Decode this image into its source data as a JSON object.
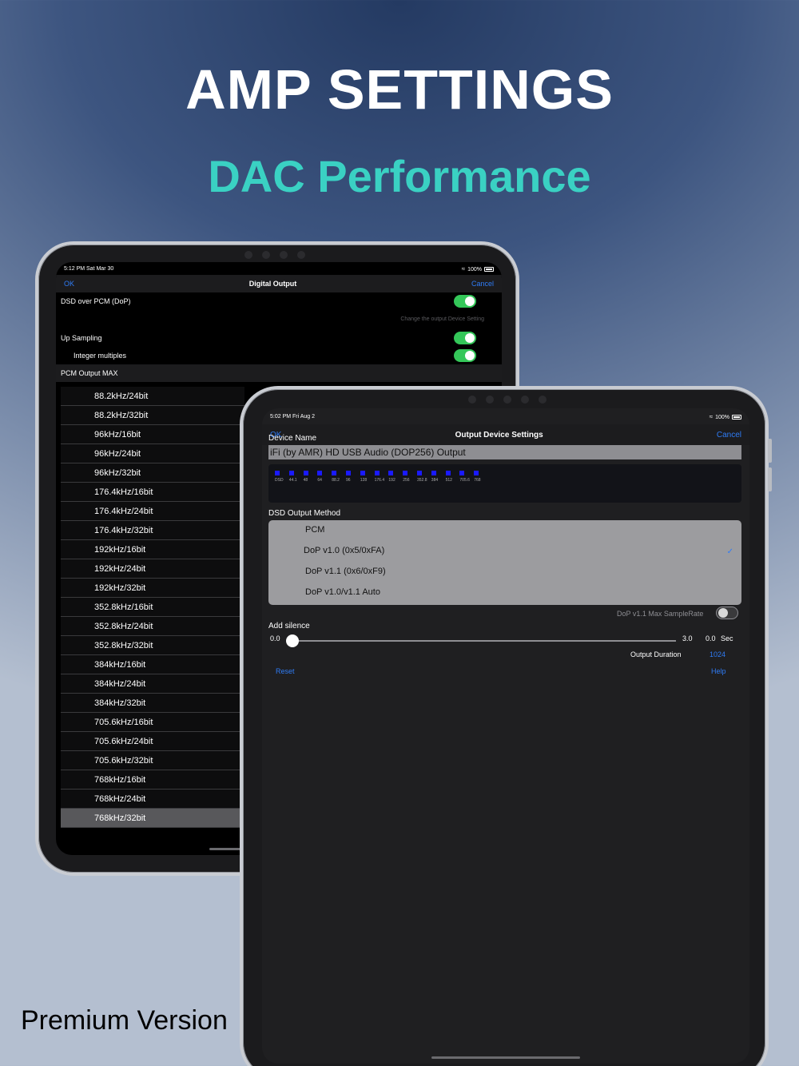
{
  "headline": "AMP SETTINGS",
  "subheadline": "DAC Performance",
  "footer_label": "Premium Version",
  "colors": {
    "accent_teal": "#3ad1c3",
    "ios_blue": "#2f7cf6",
    "toggle_green": "#34c759"
  },
  "back_device": {
    "status": {
      "time": "5:12 PM  Sat Mar 30",
      "battery": "100%"
    },
    "nav": {
      "ok": "OK",
      "title": "Digital Output",
      "cancel": "Cancel"
    },
    "dsd_over_pcm": {
      "label": "DSD over PCM (DoP)",
      "on": true
    },
    "hint": "Change the output Device Setting",
    "up_sampling": {
      "label": "Up Sampling",
      "on": true
    },
    "integer_multiples": {
      "label": "Integer multiples",
      "on": true
    },
    "pcm_header": "PCM Output MAX",
    "pcm_items": [
      "88.2kHz/24bit",
      "88.2kHz/32bit",
      "96kHz/16bit",
      "96kHz/24bit",
      "96kHz/32bit",
      "176.4kHz/16bit",
      "176.4kHz/24bit",
      "176.4kHz/32bit",
      "192kHz/16bit",
      "192kHz/24bit",
      "192kHz/32bit",
      "352.8kHz/16bit",
      "352.8kHz/24bit",
      "352.8kHz/32bit",
      "384kHz/16bit",
      "384kHz/24bit",
      "384kHz/32bit",
      "705.6kHz/16bit",
      "705.6kHz/24bit",
      "705.6kHz/32bit",
      "768kHz/16bit",
      "768kHz/24bit",
      "768kHz/32bit"
    ],
    "pcm_selected": "768kHz/32bit"
  },
  "front_device": {
    "status": {
      "time": "5:02 PM  Fri Aug 2",
      "battery": "100%"
    },
    "nav": {
      "ok": "OK",
      "title": "Output Device Settings",
      "cancel": "Cancel"
    },
    "device_name_label": "Device Name",
    "device_name_value": "iFi (by AMR) HD USB Audio (DOP256) Output",
    "rates": [
      "DSD",
      "44.1",
      "48",
      "64",
      "88.2",
      "96",
      "128",
      "176.4",
      "192",
      "256",
      "352.8",
      "384",
      "512",
      "705.6",
      "768"
    ],
    "dsd_method_label": "DSD Output Method",
    "methods": [
      "PCM",
      "DoP v1.0 (0x5/0xFA)",
      "DoP v1.1 (0x6/0xF9)",
      "DoP v1.0/v1.1 Auto"
    ],
    "method_selected": "DoP v1.0 (0x5/0xFA)",
    "check_icon": "checkmark-icon",
    "dop_max_label": "DoP v1.1 Max SampleRate",
    "dop_max_on": false,
    "add_silence_label": "Add silence",
    "slider": {
      "min_label": "0.0",
      "max_label": "3.0",
      "value": 0.0,
      "readout": "0.0",
      "unit": "Sec"
    },
    "output_duration_label": "Output Duration",
    "output_duration_value": "1024",
    "reset": "Reset",
    "help": "Help"
  }
}
